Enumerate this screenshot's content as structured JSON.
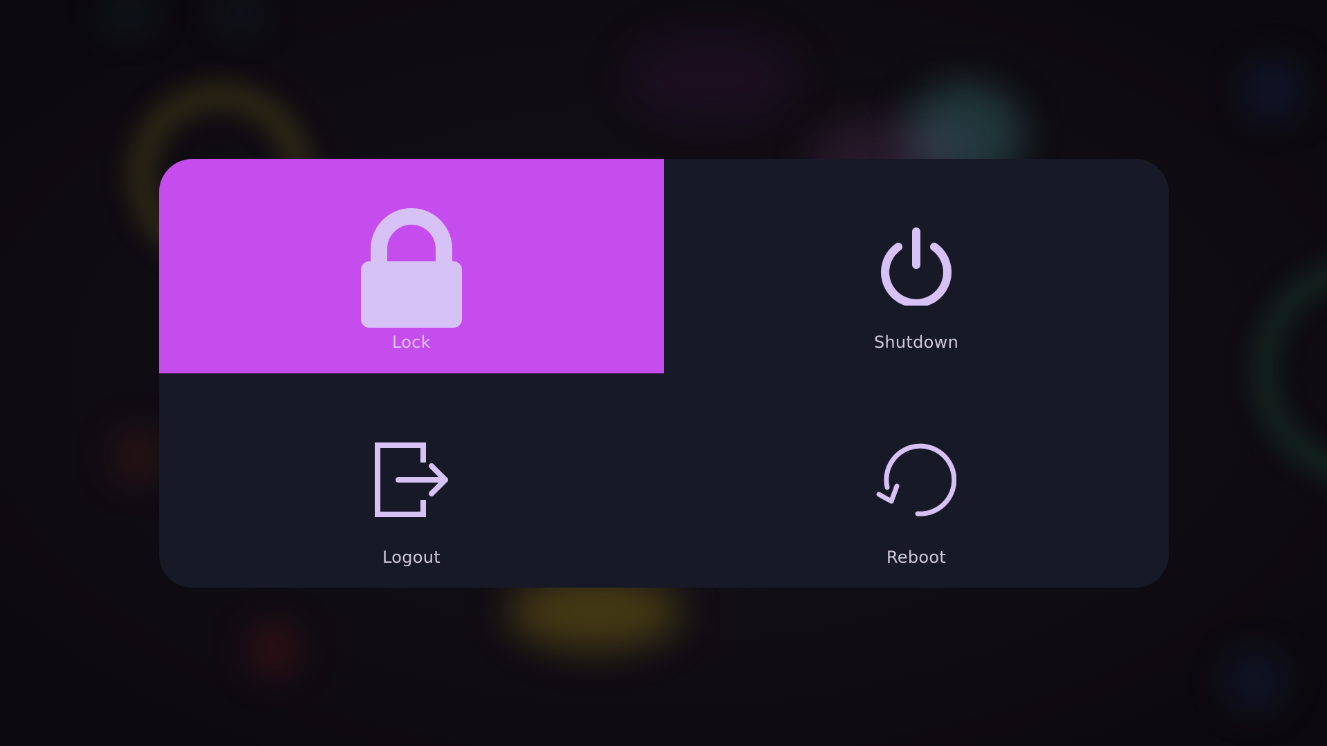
{
  "power_menu": {
    "options": [
      {
        "label": "Lock",
        "icon": "lock-icon",
        "active": true
      },
      {
        "label": "Shutdown",
        "icon": "power-icon",
        "active": false
      },
      {
        "label": "Logout",
        "icon": "logout-icon",
        "active": false
      },
      {
        "label": "Reboot",
        "icon": "reboot-icon",
        "active": false
      }
    ]
  },
  "colors": {
    "background": "#0f0c12",
    "panel": "#181926",
    "active_tile": "#c64ded",
    "icon": "#d7c2f5",
    "label": "#cfc8d8"
  }
}
